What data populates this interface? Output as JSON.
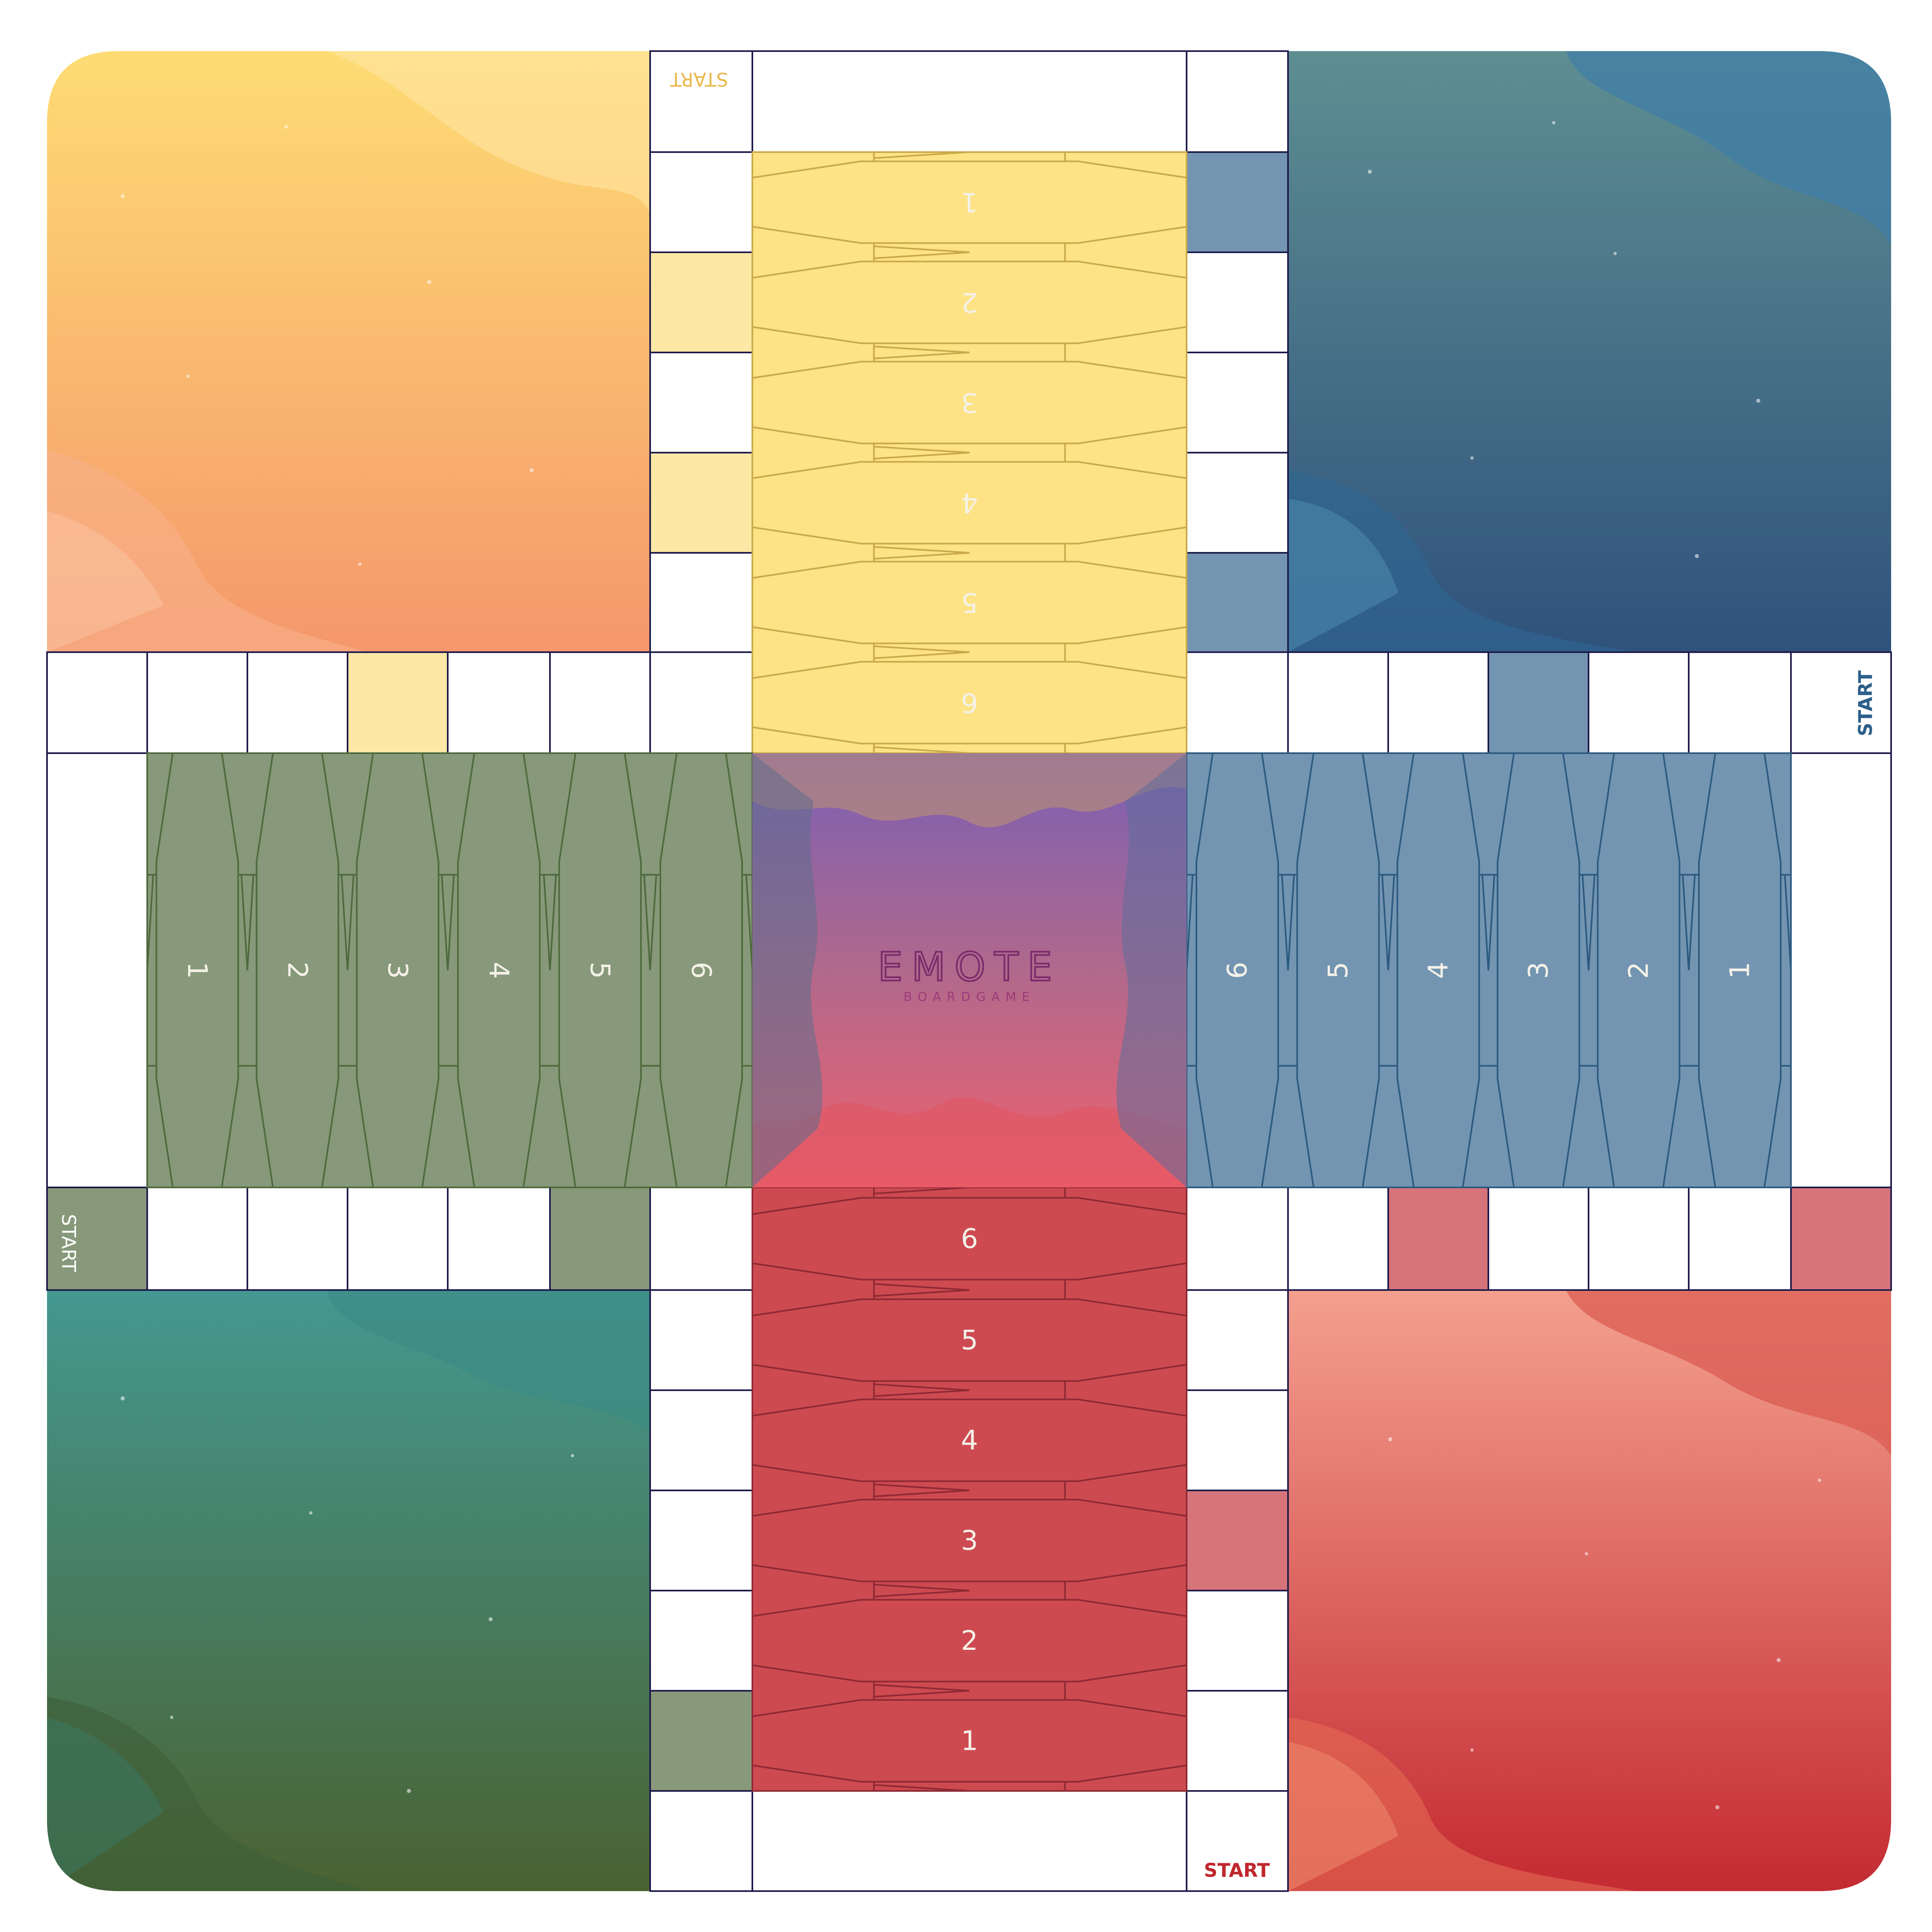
{
  "board": {
    "logo": {
      "title": "EMOTE",
      "subtitle": "BOARDGAME"
    },
    "start_label": "START",
    "home_numbers": [
      "1",
      "2",
      "3",
      "4",
      "5",
      "6"
    ],
    "colors": {
      "yellow": "#FDE385",
      "yellow_safe": "#FDE8A6",
      "yellow_line": "#C9A94A",
      "blue": "#7395B1",
      "blue_line": "#2D5A80",
      "red": "#CE4A51",
      "red_safe": "#D77479",
      "red_line": "#8E2A34",
      "green": "#87997A",
      "green_line": "#4F6A3E",
      "grid_line": "#1E1B4B",
      "start_yellow": "#E8B94E",
      "start_blue": "#2C5F8A",
      "start_red": "#C0272D",
      "start_green": "#FFFFFF"
    },
    "quadrants": [
      {
        "id": "yellow-base",
        "gradient": [
          "#FEDC74",
          "#F5976B"
        ]
      },
      {
        "id": "blue-base",
        "gradient": [
          "#5E8E92",
          "#2F527C"
        ]
      },
      {
        "id": "green-base",
        "gradient": [
          "#449890",
          "#4A6232"
        ]
      },
      {
        "id": "red-base",
        "gradient": [
          "#F4A08E",
          "#C42A32"
        ]
      }
    ],
    "center": {
      "gradient": [
        "#7A5FB4",
        "#B0698C",
        "#F0606E"
      ]
    }
  }
}
